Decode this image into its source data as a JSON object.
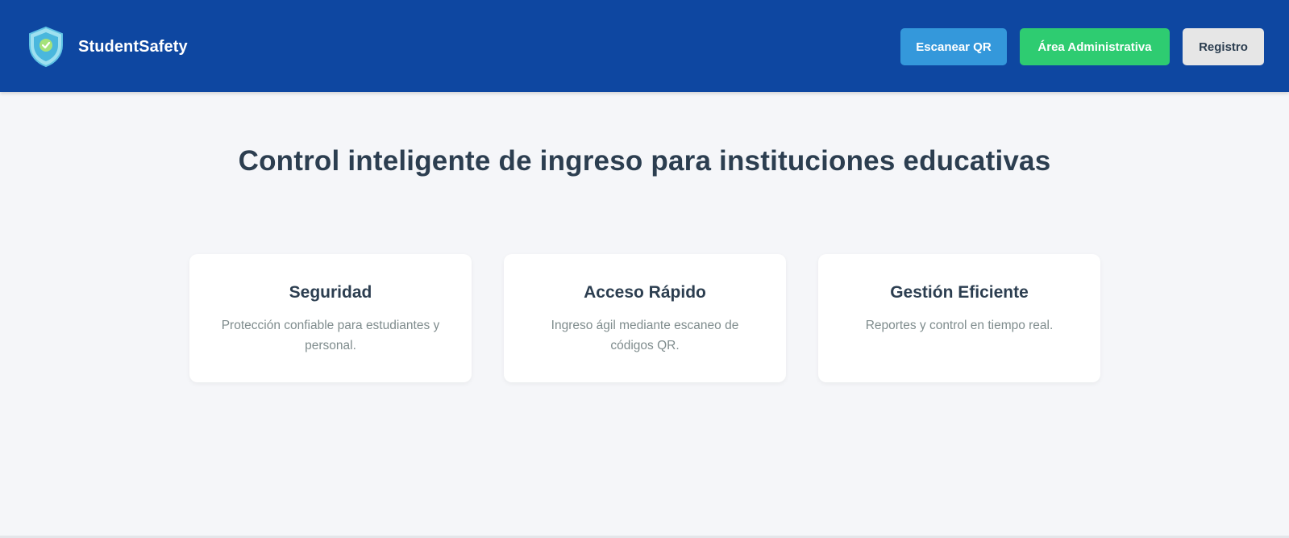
{
  "header": {
    "brand_name": "StudentSafety",
    "logo_icon": "shield-check-icon",
    "nav": {
      "scan_label": "Escanear QR",
      "admin_label": "Área Administrativa",
      "register_label": "Registro"
    }
  },
  "hero": {
    "title": "Control inteligente de ingreso para instituciones educativas"
  },
  "features": [
    {
      "title": "Seguridad",
      "description": "Protección confiable para estudiantes y personal."
    },
    {
      "title": "Acceso Rápido",
      "description": "Ingreso ágil mediante escaneo de códigos QR."
    },
    {
      "title": "Gestión Eficiente",
      "description": "Reportes y control en tiempo real."
    }
  ],
  "colors": {
    "header_bg": "#0e47a1",
    "scan_button": "#3498db",
    "admin_button": "#2ecc71",
    "register_button": "#e6e6e6",
    "heading_text": "#2c3e50",
    "body_text": "#7f8c8d",
    "page_bg": "#f5f6f9"
  }
}
